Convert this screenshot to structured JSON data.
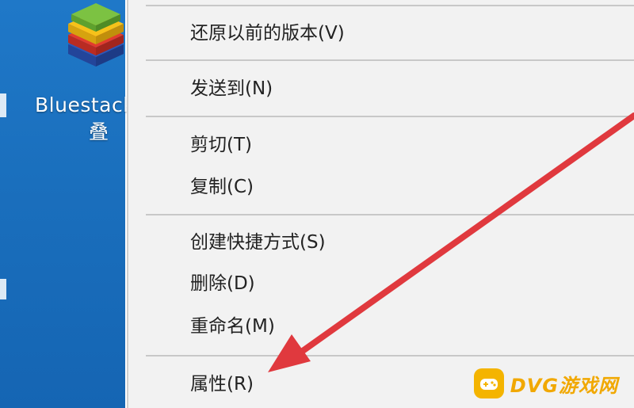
{
  "desktop": {
    "icon": {
      "name_line1": "Bluestack",
      "name_line2": "叠",
      "icon_name": "bluestacks-icon"
    }
  },
  "context_menu": {
    "items": [
      {
        "label": "还原以前的版本(V)"
      },
      {
        "label": "发送到(N)"
      },
      {
        "label": "剪切(T)"
      },
      {
        "label": "复制(C)"
      },
      {
        "label": "创建快捷方式(S)"
      },
      {
        "label": "删除(D)"
      },
      {
        "label": "重命名(M)"
      },
      {
        "label": "属性(R)"
      }
    ],
    "highlighted_item": "属性(R)"
  },
  "annotation": {
    "arrow_color": "#e0393e",
    "arrow_icon": "red-arrow-icon"
  },
  "watermark": {
    "text": "DVG游戏网",
    "color": "#f1a800"
  }
}
